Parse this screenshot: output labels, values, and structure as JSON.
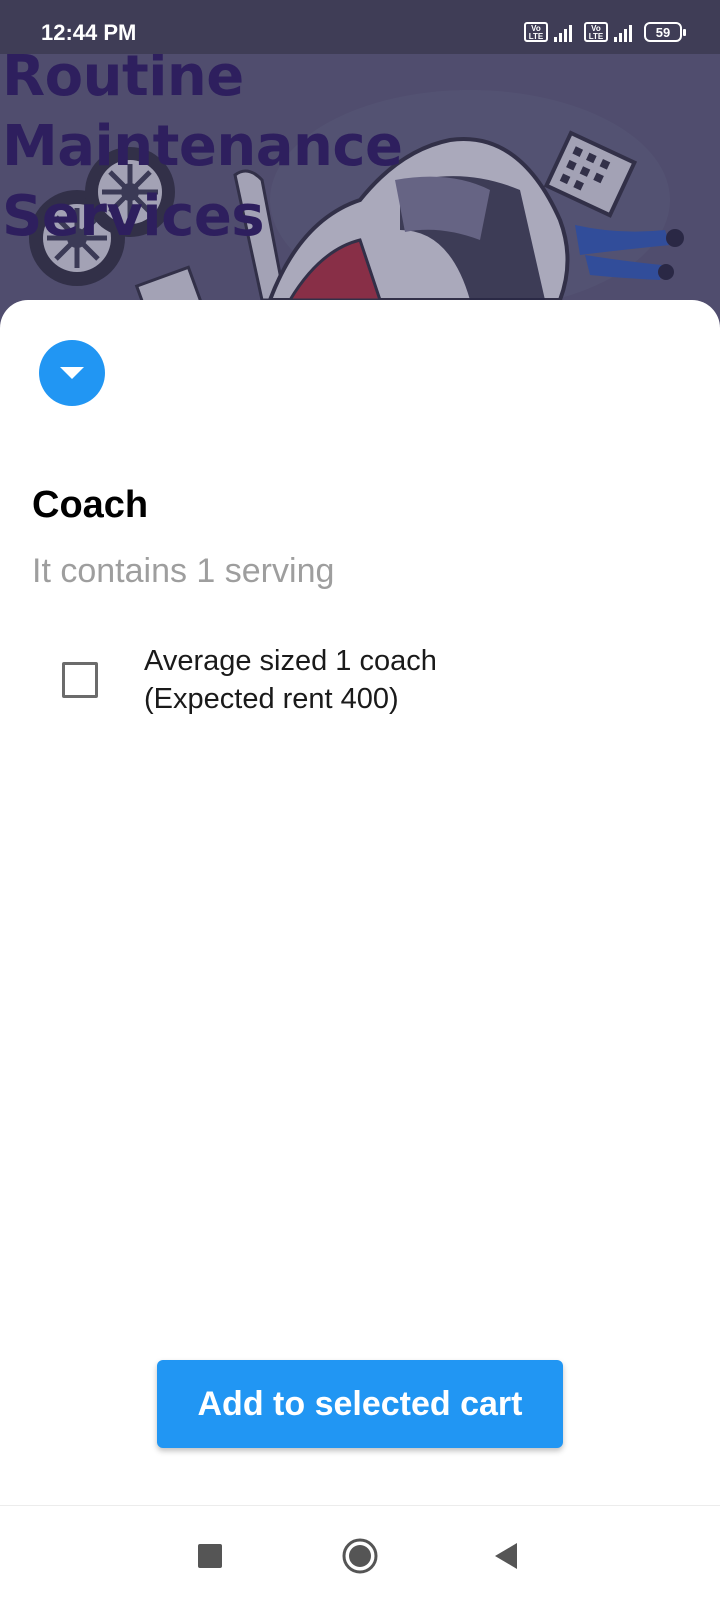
{
  "status_bar": {
    "time": "12:44 PM",
    "network_badge_1": "Vo LTE",
    "network_badge_2": "Vo LTE",
    "battery_percent": "59",
    "icons": [
      "volte-icon",
      "signal-icon",
      "volte-icon",
      "signal-icon",
      "battery-icon"
    ]
  },
  "header": {
    "title": "Routine Maintenance Services",
    "illustration": "car-maintenance-illustration"
  },
  "sheet": {
    "toggle_icon": "caret-down-icon",
    "title": "Coach",
    "subtitle": "It contains 1 serving",
    "options": [
      {
        "line1": "Average sized 1 coach",
        "line2": "(Expected rent 400)",
        "checked": false
      }
    ],
    "add_button_label": "Add to selected cart"
  },
  "nav_bar": {
    "icons": [
      "recents-square-icon",
      "home-circle-icon",
      "back-triangle-icon"
    ]
  },
  "colors": {
    "accent": "#2196f3",
    "status_bar": "#3f3d56",
    "header_overlay": "#5a5877",
    "title_text": "#2e1f5e",
    "subtitle_text": "#9e9e9e"
  }
}
